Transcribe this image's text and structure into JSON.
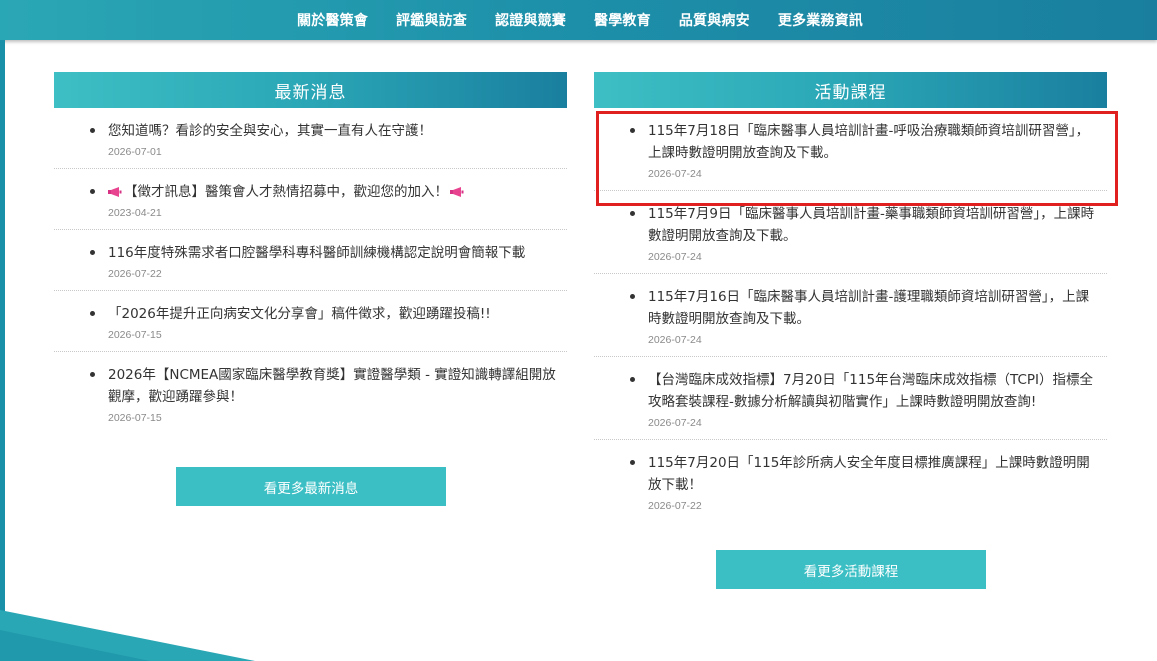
{
  "nav": {
    "items": [
      "關於醫策會",
      "評鑑與訪查",
      "認證與競賽",
      "醫學教育",
      "品質與病安",
      "更多業務資訊"
    ]
  },
  "news": {
    "header": "最新消息",
    "items": [
      {
        "title": "您知道嗎？看診的安全與安心，其實一直有人在守護！",
        "date": "2026-07-01",
        "icon": ""
      },
      {
        "title": "【徵才訊息】醫策會人才熱情招募中，歡迎您的加入！",
        "date": "2023-04-21",
        "icon": "megaphone-icon"
      },
      {
        "title": "116年度特殊需求者口腔醫學科專科醫師訓練機構認定說明會簡報下載",
        "date": "2026-07-22",
        "icon": ""
      },
      {
        "title": "「2026年提升正向病安文化分享會」稿件徵求，歡迎踴躍投稿!!",
        "date": "2026-07-15",
        "icon": ""
      },
      {
        "title": "2026年【NCMEA國家臨床醫學教育獎】實證醫學類 - 實證知識轉譯組開放觀摩，歡迎踴躍參與！",
        "date": "2026-07-15",
        "icon": ""
      }
    ],
    "more_label": "看更多最新消息"
  },
  "courses": {
    "header": "活動課程",
    "items": [
      {
        "title": "115年7月18日「臨床醫事人員培訓計畫-呼吸治療職類師資培訓研習營」，上課時數證明開放查詢及下載。",
        "date": "2026-07-24"
      },
      {
        "title": "115年7月9日「臨床醫事人員培訓計畫-藥事職類師資培訓研習營」，上課時數證明開放查詢及下載。",
        "date": "2026-07-24"
      },
      {
        "title": "115年7月16日「臨床醫事人員培訓計畫-護理職類師資培訓研習營」，上課時數證明開放查詢及下載。",
        "date": "2026-07-24"
      },
      {
        "title": "【台灣臨床成效指標】7月20日「115年台灣臨床成效指標（TCPI）指標全攻略套裝課程-數據分析解讀與初階實作」上課時數證明開放查詢!",
        "date": "2026-07-24"
      },
      {
        "title": "115年7月20日「115年診所病人安全年度目標推廣課程」上課時數證明開放下載！",
        "date": "2026-07-22"
      }
    ],
    "more_label": "看更多活動課程"
  },
  "colors": {
    "accent": "#3bbfc4",
    "nav_start": "#2aa7b4",
    "nav_end": "#1a7f9f",
    "highlight": "#e0201e"
  }
}
